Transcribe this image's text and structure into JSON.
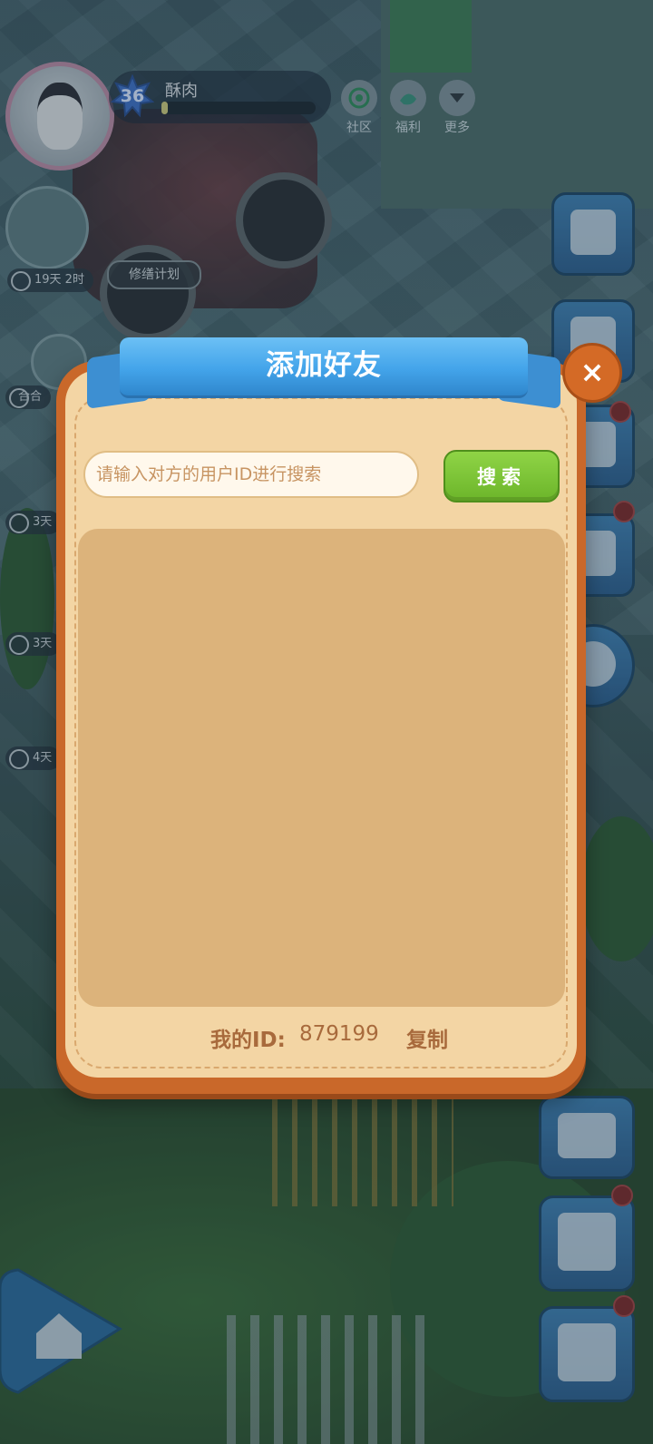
{
  "hud": {
    "level": "36",
    "player_name": "酥肉",
    "xp_progress": 0.04,
    "buttons": [
      {
        "label": "社区",
        "icon": "community-icon"
      },
      {
        "label": "福利",
        "icon": "welfare-icon"
      },
      {
        "label": "更多",
        "icon": "more-icon"
      }
    ],
    "event_timer_1": "19天 2时",
    "plan_label": "修缮计划",
    "side_label": "合合",
    "timer_2": "3天",
    "timer_3": "3天",
    "timer_4": "4天"
  },
  "dialog": {
    "title": "添加好友",
    "close_label": "×",
    "search_placeholder": "请输入对方的用户ID进行搜索",
    "search_value": "",
    "search_button": "搜索",
    "my_id_label": "我的ID:",
    "my_id_value": "879199",
    "copy_button": "复制"
  },
  "colors": {
    "ribbon": "#43a4ea",
    "dialog_border": "#c9682a",
    "dialog_fill": "#f3d5a4",
    "search_button": "#7cc334"
  }
}
